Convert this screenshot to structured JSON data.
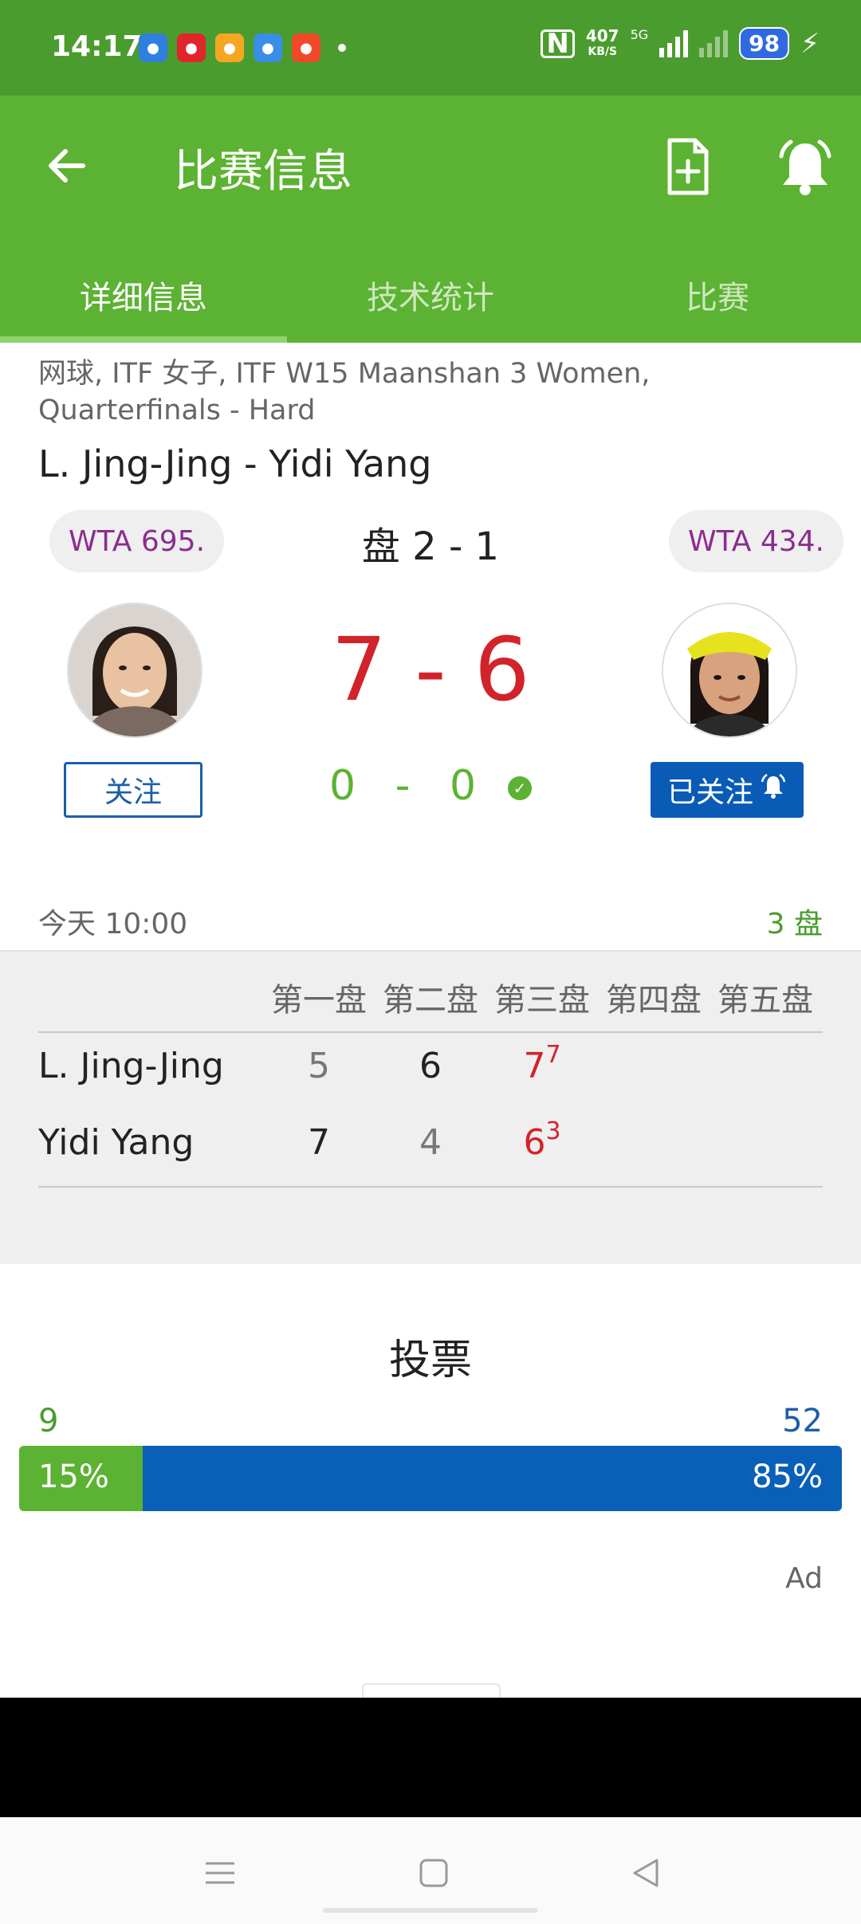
{
  "status_bar": {
    "time": "14:17",
    "net_speed_value": "407",
    "net_speed_unit": "KB/S",
    "network_type": "5G",
    "battery": "98",
    "apps": [
      {
        "icon": "cloud-app-icon",
        "color": "#2f7fe0"
      },
      {
        "icon": "red-packet-app-icon",
        "color": "#e0262b"
      },
      {
        "icon": "weibo-app-icon",
        "color": "#f5a623"
      },
      {
        "icon": "browser-app-icon",
        "color": "#3a8ee6"
      },
      {
        "icon": "video-app-icon",
        "color": "#f04a2a"
      }
    ]
  },
  "app_bar": {
    "title": "比赛信息",
    "tabs": [
      "详细信息",
      "技术统计",
      "比赛"
    ],
    "active_tab": 0,
    "accent_color": "#5cb232"
  },
  "match": {
    "tournament": "网球, ITF 女子, ITF W15 Maanshan 3 Women, Quarterfinals - Hard",
    "title": "L. Jing-Jing - Yidi Yang",
    "sets_summary": "盘 2 - 1",
    "current_set_score": "7 - 6",
    "game_score": "0   -   0",
    "date": "今天 10:00",
    "best_of": "3 盘",
    "player1": {
      "name": "L. Jing-Jing",
      "rank": "WTA 695.",
      "follow_label": "关注"
    },
    "player2": {
      "name": "Yidi Yang",
      "rank": "WTA 434.",
      "follow_label": "已关注"
    }
  },
  "score_table": {
    "headers": [
      "第一盘",
      "第二盘",
      "第三盘",
      "第四盘",
      "第五盘"
    ],
    "rows": [
      {
        "name": "L. Jing-Jing",
        "sets": [
          "5",
          "6",
          "7"
        ],
        "tiebreak": "7"
      },
      {
        "name": "Yidi Yang",
        "sets": [
          "7",
          "4",
          "6"
        ],
        "tiebreak": "3"
      }
    ]
  },
  "vote": {
    "title": "投票",
    "left_count": "9",
    "right_count": "52",
    "left_pct_label": "15%",
    "right_pct_label": "85%",
    "left_fraction": 0.15
  },
  "ad_label": "Ad"
}
